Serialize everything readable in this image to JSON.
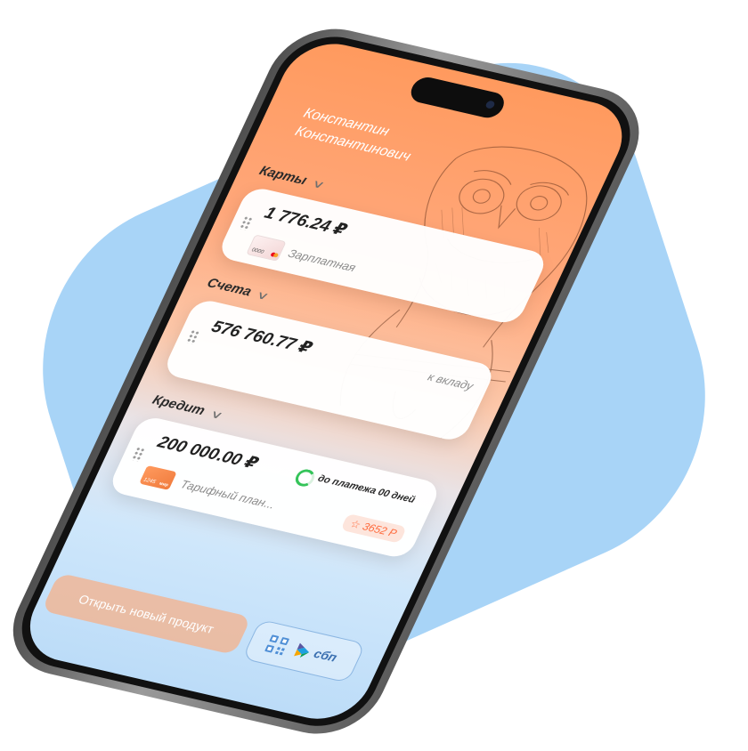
{
  "user": {
    "first_name": "Константин",
    "patronymic": "Константинович"
  },
  "sections": {
    "cards": {
      "title": "Карты",
      "chevron": "chevron-down-icon"
    },
    "accounts": {
      "title": "Счета",
      "chevron": "chevron-down-icon"
    },
    "credit": {
      "title": "Кредит",
      "chevron": "chevron-down-icon"
    }
  },
  "card_item": {
    "amount": "1 776.24 ₽",
    "card_number": "0000",
    "label": "Зарплатная"
  },
  "account_item": {
    "amount": "576 760.77 ₽",
    "tag": "к вкладу"
  },
  "credit_item": {
    "amount": "200 000.00 ₽",
    "payment_status": "до платежа 00 дней",
    "card_number": "1245",
    "card_brand": "мир",
    "tariff": "Тарифный план...",
    "bonus": "3652 Р"
  },
  "actions": {
    "open_product": "Открыть новый продукт",
    "sbp_label": "сбп"
  },
  "colors": {
    "accent": "#ff8a4c",
    "background_blob": "#a8d4f7",
    "progress": "#35c45a",
    "bonus": "#ff6b3d"
  }
}
